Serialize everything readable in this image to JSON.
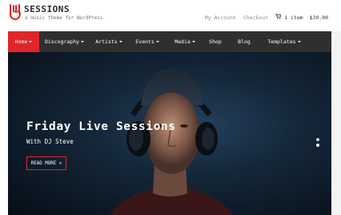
{
  "site": {
    "title": "SESSIONS",
    "tagline": "a music theme for WordPress",
    "logo_icon": "rock-hand-icon"
  },
  "top_links": {
    "account": "My Account",
    "checkout": "Checkout",
    "cart": "1 item  $39.00",
    "cart_icon": "shopping-cart-icon"
  },
  "nav": {
    "items": [
      {
        "label": "Home"
      },
      {
        "label": "Discography"
      },
      {
        "label": "Artists"
      },
      {
        "label": "Events"
      },
      {
        "label": "Media"
      },
      {
        "label": "Shop"
      },
      {
        "label": "Blog"
      },
      {
        "label": "Templates"
      }
    ]
  },
  "slider": {
    "title": "Friday Live Sessions",
    "subtitle": "With DJ Steve",
    "button": "READ MORE »",
    "slide_count": 2,
    "active_index": 1
  },
  "colors": {
    "accent": "#e0262a",
    "nav_bg": "#2f2f2f"
  }
}
